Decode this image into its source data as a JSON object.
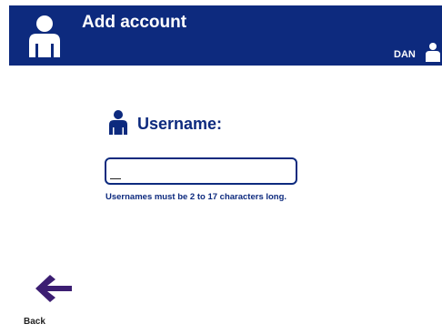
{
  "header": {
    "title": "Add account",
    "user_name": "DAN",
    "icon": "person-icon"
  },
  "prompt": {
    "label": "Username:",
    "icon": "person-icon"
  },
  "username_input": {
    "value": "",
    "placeholder": ""
  },
  "hint": "Usernames must be 2 to 17 characters long.",
  "back": {
    "label": "Back",
    "icon": "back-arrow-icon"
  },
  "colors": {
    "primary": "#0d2a7e",
    "accent": "#3c1e72",
    "background": "#ffffff"
  }
}
